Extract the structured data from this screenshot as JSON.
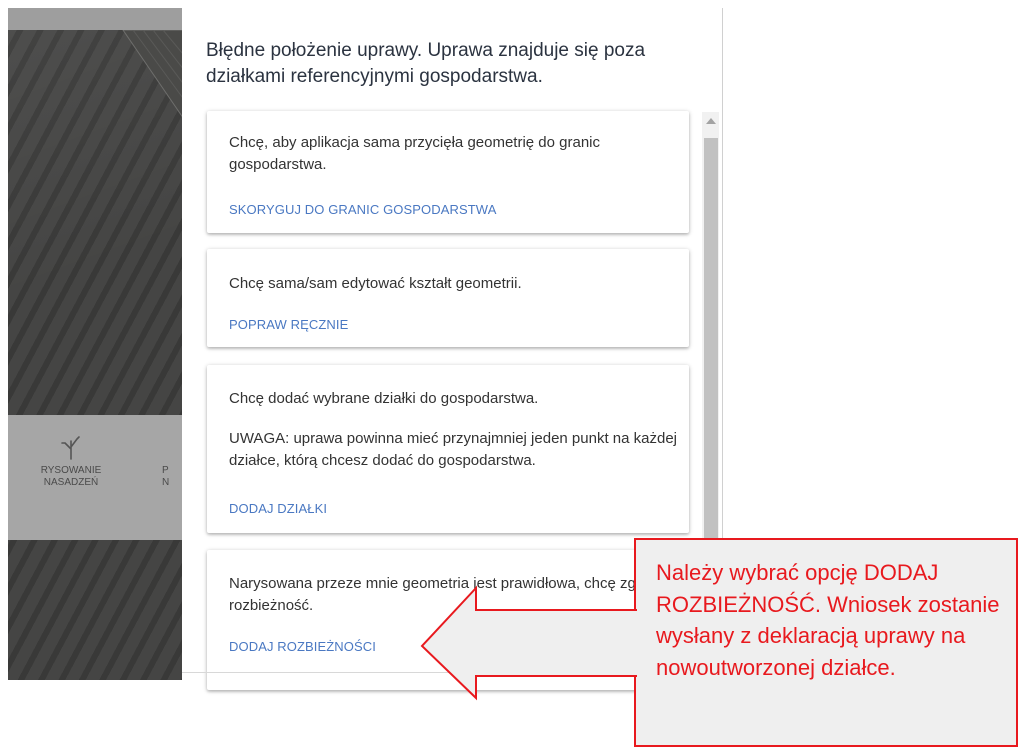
{
  "map": {
    "toolbar": {
      "tool1_label_line1": "RYSOWANIE",
      "tool1_label_line2": "NASADZEŃ",
      "tool2_label_line1": "P",
      "tool2_label_line2": "N"
    }
  },
  "dialog": {
    "title": "Błędne położenie uprawy. Uprawa znajduje się poza działkami referencyjnymi gospodarstwa.",
    "options": [
      {
        "description": "Chcę, aby aplikacja sama przycięła geometrię do granic gospodarstwa.",
        "action": "SKORYGUJ DO GRANIC GOSPODARSTWA"
      },
      {
        "description": "Chcę sama/sam edytować kształt geometrii.",
        "action": "POPRAW RĘCZNIE"
      },
      {
        "description": "Chcę dodać wybrane działki do gospodarstwa.",
        "warning": "UWAGA: uprawa powinna mieć przynajmniej jeden punkt na każdej działce, którą chcesz dodać do gospodarstwa.",
        "action": "DODAJ DZIAŁKI"
      },
      {
        "description": "Narysowana przeze mnie geometria jest prawidłowa, chcę zgłosić rozbieżność.",
        "action": "DODAJ ROZBIEŻNOŚCI"
      }
    ]
  },
  "callout": {
    "text": "Należy wybrać opcję DODAJ ROZBIEŻNOŚĆ. Wniosek zostanie wysłany z deklaracją uprawy na nowoutworzonej działce."
  },
  "colors": {
    "action_blue": "#4a78c2",
    "callout_red": "#e8191e",
    "title_text": "#2b3340"
  }
}
